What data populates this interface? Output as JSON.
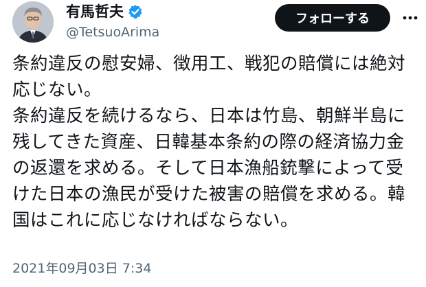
{
  "author": {
    "display_name": "有馬哲夫",
    "handle": "@TetsuoArima",
    "verified": true
  },
  "follow_button": {
    "label": "フォローする"
  },
  "more_icon": "more-horizontal-icon",
  "tweet": {
    "paragraphs": [
      "条約違反の慰安婦、徴用工、戦犯の賠償には絶対応じない。",
      "条約違反を続けるなら、日本は竹島、朝鮮半島に残してきた資産、日韓基本条約の際の経済協力金の返還を求める。そして日本漁船銃撃によって受けた日本の漁民が受けた被害の賠償を求める。韓国はこれに応じなければならない。"
    ],
    "timestamp": "2021年09月03日 7:34"
  },
  "colors": {
    "follow_bg": "#0f1419",
    "verified_blue": "#1d9bf0",
    "secondary_text": "#536471"
  }
}
